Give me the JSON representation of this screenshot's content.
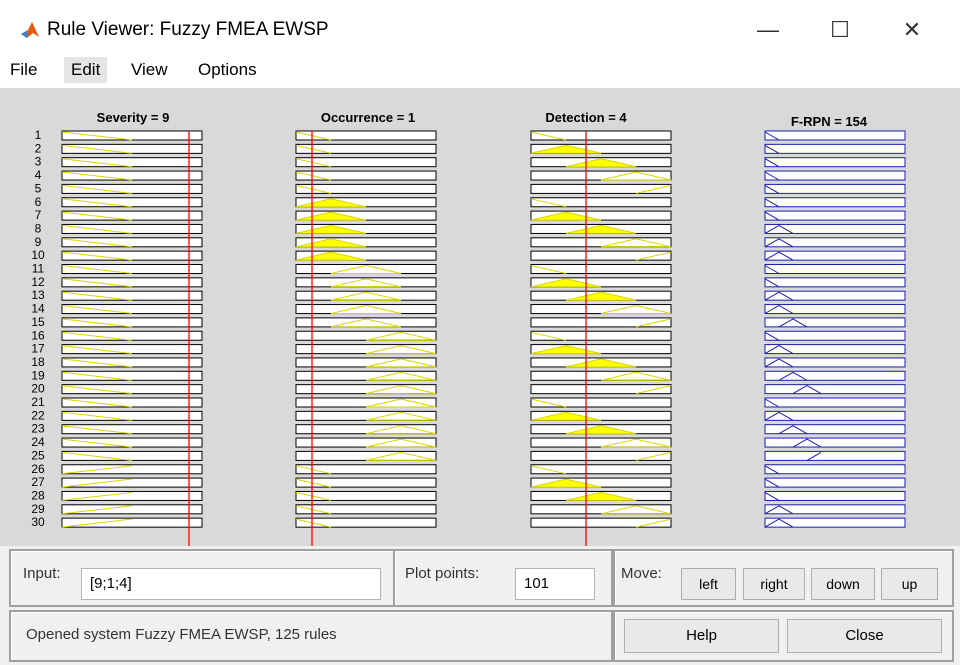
{
  "window": {
    "title": "Rule Viewer: Fuzzy FMEA EWSP",
    "minimize_glyph": "—",
    "maximize_glyph": "☐",
    "close_glyph": "✕",
    "icon": "matlab-logo-icon"
  },
  "menu": [
    "File",
    "Edit",
    "View",
    "Options"
  ],
  "plots": {
    "columns": [
      {
        "title": "Severity = 9",
        "type": "input",
        "value": 9
      },
      {
        "title": "Occurrence = 1",
        "type": "input",
        "value": 1
      },
      {
        "title": "Detection = 4",
        "type": "input",
        "value": 4
      },
      {
        "title": "F-RPN = 154",
        "type": "output",
        "value": 154
      }
    ],
    "rule_numbers": [
      "1",
      "2",
      "3",
      "4",
      "5",
      "6",
      "7",
      "8",
      "9",
      "10",
      "11",
      "12",
      "13",
      "14",
      "15",
      "16",
      "17",
      "18",
      "19",
      "20",
      "21",
      "22",
      "23",
      "24",
      "25",
      "26",
      "27",
      "28",
      "29",
      "30"
    ]
  },
  "input": {
    "label": "Input:",
    "value": "[9;1;4]"
  },
  "plot_points": {
    "label": "Plot points:",
    "value": "101"
  },
  "move": {
    "label": "Move:",
    "left": "left",
    "right": "right",
    "down": "down",
    "up": "up"
  },
  "status": "Opened system Fuzzy FMEA EWSP, 125 rules",
  "buttons": {
    "help": "Help",
    "close": "Close"
  },
  "colors": {
    "plot_bg": "#d9d9d9",
    "input_mf": "#d6d600",
    "fill": "#ffff00",
    "output_mf": "#1c1cb0",
    "marker": "#ff0000"
  }
}
